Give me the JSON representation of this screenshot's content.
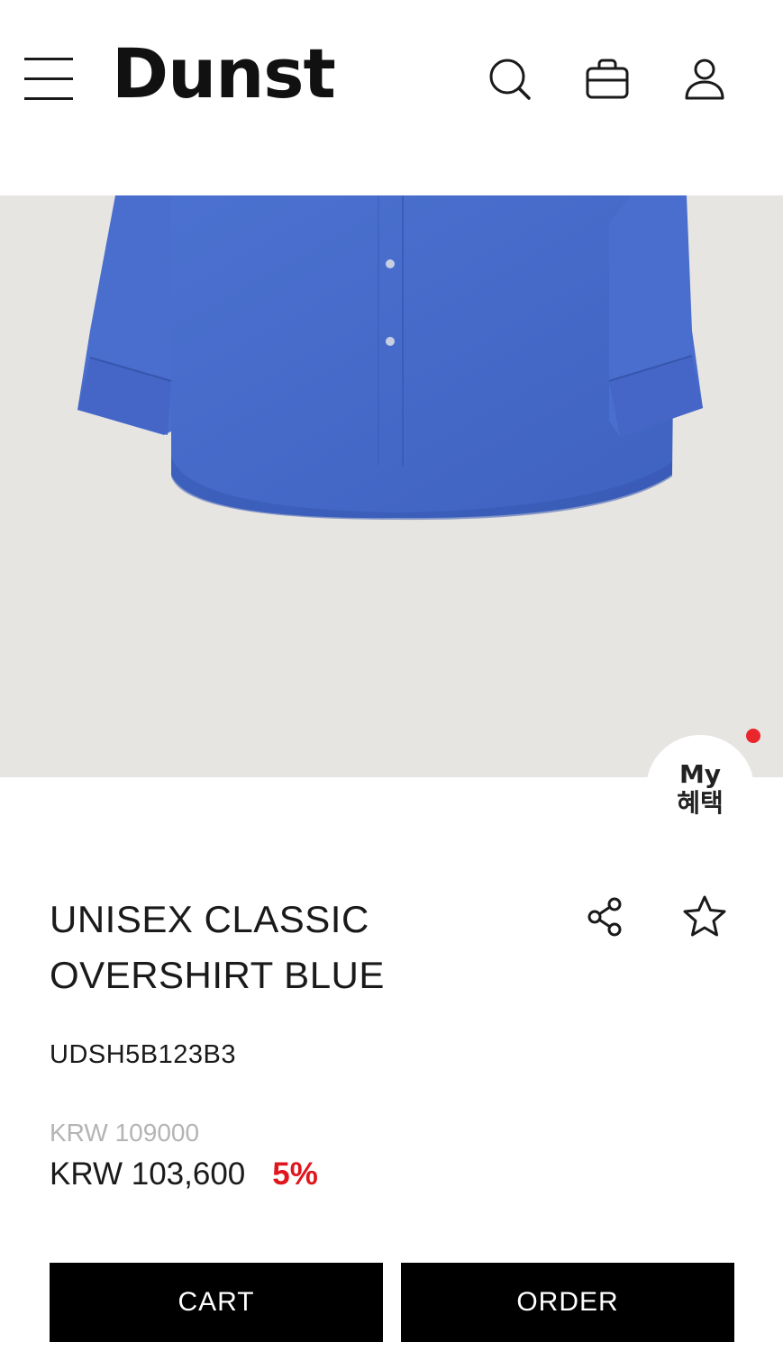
{
  "header": {
    "brand": "Dunst",
    "icons": [
      "menu-icon",
      "search-icon",
      "shopping-bag-icon",
      "user-icon"
    ]
  },
  "benefit_badge": {
    "line1": "My",
    "line2": "혜택"
  },
  "product": {
    "name_line1": "UNISEX CLASSIC",
    "name_line2": "OVERSHIRT BLUE",
    "sku": "UDSH5B123B3",
    "original_price": "KRW 109000",
    "sale_price": "KRW 103,600",
    "discount": "5%",
    "image_color": "#4a6fcf"
  },
  "actions": {
    "cart_label": "CART",
    "order_label": "ORDER"
  },
  "colors": {
    "accent_red": "#e0161e",
    "button_bg": "#000000",
    "hero_bg": "#e7e5e2"
  }
}
